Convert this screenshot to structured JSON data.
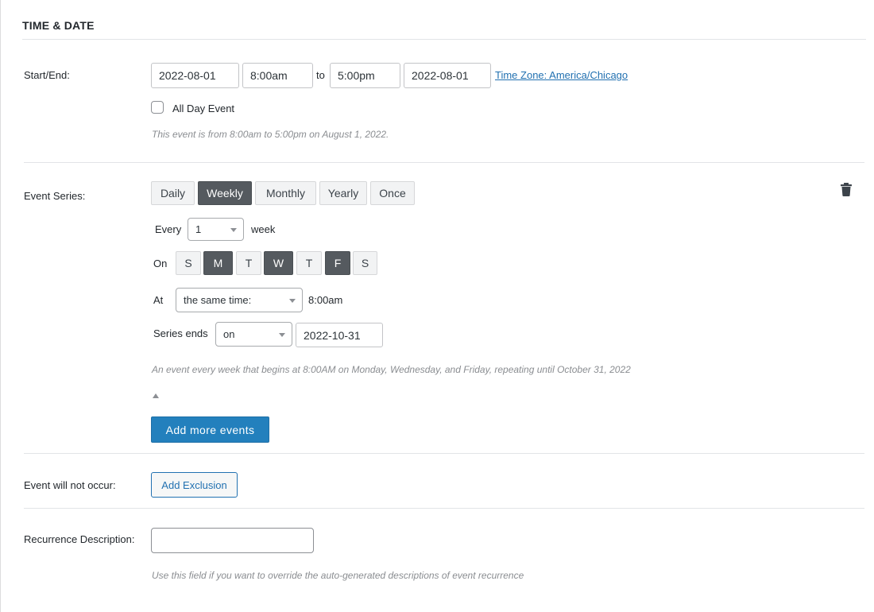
{
  "section": {
    "title": "TIME & DATE"
  },
  "start_end": {
    "label": "Start/End:",
    "start_date": "2022-08-01",
    "start_time": "8:00am",
    "to_text": "to",
    "end_time": "5:00pm",
    "end_date": "2022-08-01",
    "timezone_link": "Time Zone: America/Chicago",
    "all_day_label": "All Day Event",
    "all_day_checked": false,
    "summary": "This event is from 8:00am to 5:00pm on August 1, 2022."
  },
  "series": {
    "label": "Event Series:",
    "frequency_tabs": [
      "Daily",
      "Weekly",
      "Monthly",
      "Yearly",
      "Once"
    ],
    "active_frequency": "Weekly",
    "every_label": "Every",
    "every_value": "1",
    "every_unit": "week",
    "on_label": "On",
    "days": [
      "S",
      "M",
      "T",
      "W",
      "T",
      "F",
      "S"
    ],
    "days_active": [
      false,
      true,
      false,
      true,
      false,
      true,
      false
    ],
    "at_label": "At",
    "at_select": "the same time:",
    "at_time": "8:00am",
    "ends_label": "Series ends",
    "ends_select": "on",
    "ends_date": "2022-10-31",
    "summary": "An event every week that begins at 8:00AM on Monday, Wednesday, and Friday, repeating until October 31, 2022",
    "add_more_button": "Add more events",
    "trash_icon": "trash-icon"
  },
  "exclusion": {
    "label": "Event will not occur:",
    "button": "Add Exclusion"
  },
  "recurrence": {
    "label": "Recurrence Description:",
    "input_value": "",
    "help": "Use this field if you want to override the auto-generated descriptions of event recurrence"
  }
}
